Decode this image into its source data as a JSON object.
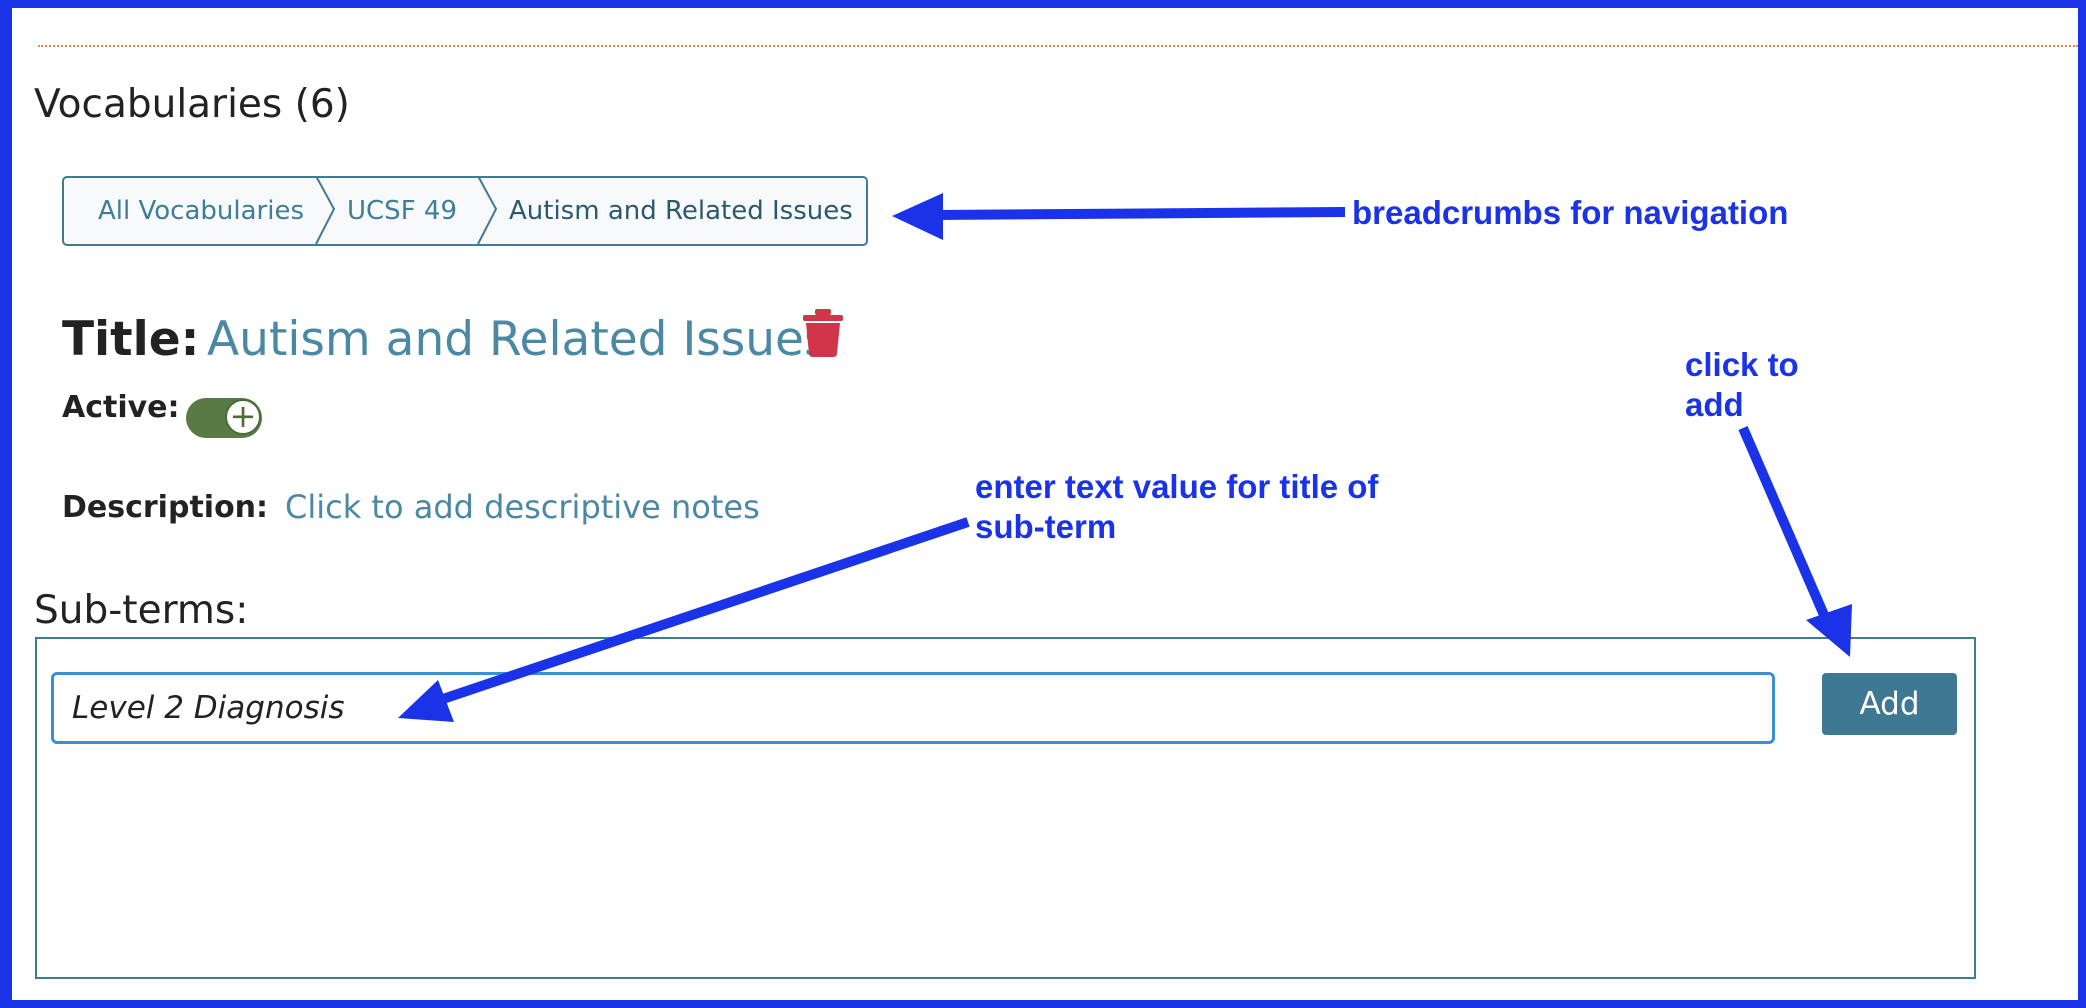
{
  "page": {
    "heading": "Vocabularies (6)"
  },
  "breadcrumb": {
    "items": [
      "All Vocabularies",
      "UCSF 49",
      "Autism and Related Issues"
    ]
  },
  "term": {
    "title_label": "Title:",
    "title_value": "Autism and Related Issues",
    "active_label": "Active:",
    "active": true,
    "description_label": "Description:",
    "description_value": "Click to add descriptive notes"
  },
  "subterms": {
    "label": "Sub-terms:",
    "input_value": "Level 2 Diagnosis",
    "add_label": "Add"
  },
  "annotations": {
    "breadcrumbs_note": "breadcrumbs for navigation",
    "input_note": "enter text value for title of\nsub-term",
    "add_note": "click to\nadd"
  },
  "colors": {
    "annotation": "#1a33e8",
    "accent": "#4a88a3",
    "delete": "#d0354a",
    "toggle_on": "#5a7a45",
    "button": "#3f7893"
  },
  "icons": {
    "delete": "trash-icon",
    "toggle": "plus-icon"
  }
}
